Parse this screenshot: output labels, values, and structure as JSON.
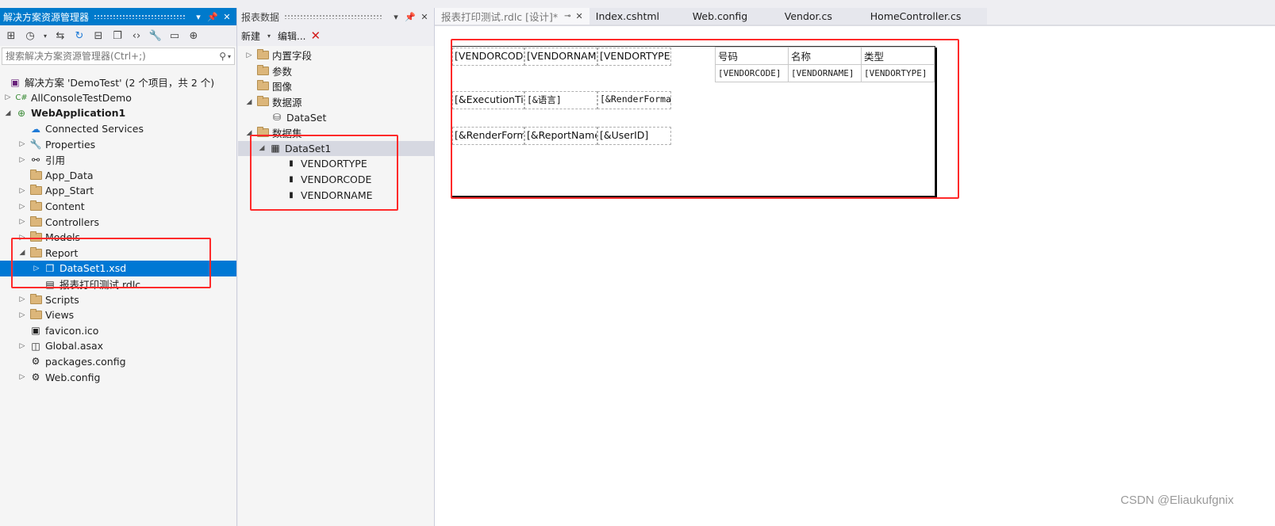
{
  "solution_explorer": {
    "title": "解决方案资源管理器",
    "search_placeholder": "搜索解决方案资源管理器(Ctrl+;)",
    "items": [
      {
        "label": "解决方案 'DemoTest' (2 个项目，共 2 个)",
        "icon": "solution-icon"
      },
      {
        "label": "AllConsoleTestDemo",
        "icon": "console-project-icon"
      },
      {
        "label": "WebApplication1",
        "icon": "web-project-icon"
      },
      {
        "label": "Connected Services",
        "icon": "connected-services-icon"
      },
      {
        "label": "Properties",
        "icon": "wrench-icon"
      },
      {
        "label": "引用",
        "icon": "references-icon"
      },
      {
        "label": "App_Data",
        "icon": "folder-icon"
      },
      {
        "label": "App_Start",
        "icon": "folder-icon"
      },
      {
        "label": "Content",
        "icon": "folder-icon"
      },
      {
        "label": "Controllers",
        "icon": "folder-icon"
      },
      {
        "label": "Models",
        "icon": "folder-icon"
      },
      {
        "label": "Report",
        "icon": "folder-open-icon"
      },
      {
        "label": "DataSet1.xsd",
        "icon": "dataset-icon"
      },
      {
        "label": "报表打印测试.rdlc",
        "icon": "report-file-icon"
      },
      {
        "label": "Scripts",
        "icon": "folder-icon"
      },
      {
        "label": "Views",
        "icon": "folder-icon"
      },
      {
        "label": "favicon.ico",
        "icon": "image-file-icon"
      },
      {
        "label": "Global.asax",
        "icon": "global-asax-icon"
      },
      {
        "label": "packages.config",
        "icon": "config-icon"
      },
      {
        "label": "Web.config",
        "icon": "config-icon"
      }
    ]
  },
  "report_data": {
    "title": "报表数据",
    "toolbar": {
      "new_label": "新建",
      "edit_label": "编辑..."
    },
    "items": [
      {
        "label": "内置字段",
        "icon": "folder-icon"
      },
      {
        "label": "参数",
        "icon": "folder-icon"
      },
      {
        "label": "图像",
        "icon": "folder-icon"
      },
      {
        "label": "数据源",
        "icon": "folder-open-icon"
      },
      {
        "label": "DataSet",
        "icon": "database-icon"
      },
      {
        "label": "数据集",
        "icon": "folder-open-icon"
      },
      {
        "label": "DataSet1",
        "icon": "table-icon"
      },
      {
        "label": "VENDORTYPE",
        "icon": "field-icon"
      },
      {
        "label": "VENDORCODE",
        "icon": "field-icon"
      },
      {
        "label": "VENDORNAME",
        "icon": "field-icon"
      }
    ]
  },
  "tabs": [
    {
      "label": "报表打印测试.rdlc [设计]*",
      "active": true
    },
    {
      "label": "Index.cshtml"
    },
    {
      "label": "Web.config"
    },
    {
      "label": "Vendor.cs"
    },
    {
      "label": "HomeController.cs"
    }
  ],
  "report": {
    "textboxes": [
      "[VENDORCODE]",
      "[VENDORNAME]",
      "[VENDORTYPE]",
      "[&ExecutionTime]",
      "[&语言]",
      "[&RenderFormat]",
      "[&RenderFormat]",
      "[&ReportName]",
      "[&UserID]"
    ],
    "table": {
      "headers": [
        "号码",
        "名称",
        "类型"
      ],
      "row": [
        "[VENDORCODE]",
        "[VENDORNAME]",
        "[VENDORTYPE]"
      ]
    }
  },
  "watermark": "CSDN @Eliaukufgnix",
  "colors": {
    "accent": "#007acc",
    "selected": "#0078d4",
    "highlight": "#ff2a2a"
  }
}
